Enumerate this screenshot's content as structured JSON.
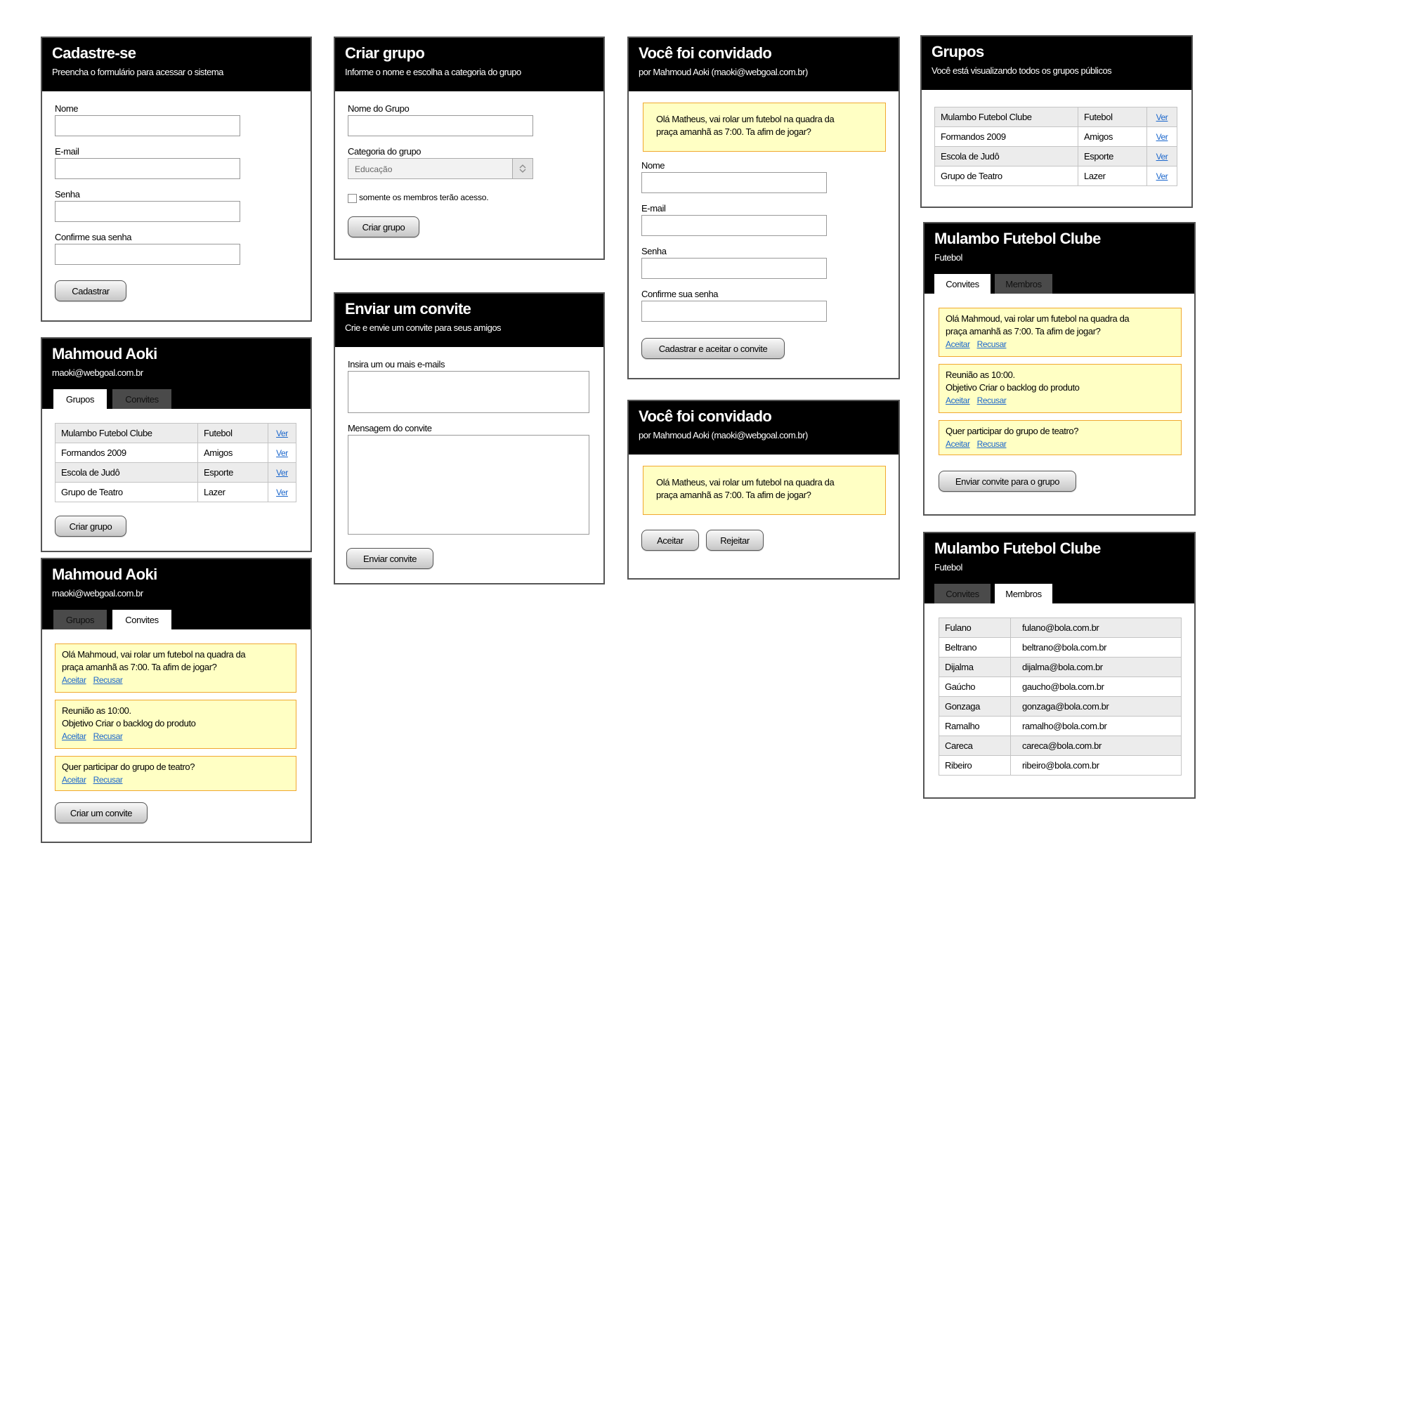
{
  "signup": {
    "title": "Cadastre-se",
    "subtitle": "Preencha o formulário para acessar o sistema",
    "fields": [
      "Nome",
      "E-mail",
      "Senha",
      "Confirme sua senha"
    ],
    "submit": "Cadastrar"
  },
  "profile_groups": {
    "name": "Mahmoud Aoki",
    "email": "maoki@webgoal.com.br",
    "tabs": [
      "Grupos",
      "Convites"
    ],
    "rows": [
      {
        "name": "Mulambo Futebol Clube",
        "category": "Futebol",
        "link": "Ver"
      },
      {
        "name": "Formandos 2009",
        "category": "Amigos",
        "link": "Ver"
      },
      {
        "name": "Escola de Judô",
        "category": "Esporte",
        "link": "Ver"
      },
      {
        "name": "Grupo de Teatro",
        "category": "Lazer",
        "link": "Ver"
      }
    ],
    "button": "Criar grupo"
  },
  "profile_invites": {
    "name": "Mahmoud Aoki",
    "email": "maoki@webgoal.com.br",
    "tabs": [
      "Grupos",
      "Convites"
    ],
    "invites": [
      {
        "line1": "Olá Mahmoud, vai rolar um futebol na quadra da",
        "line2": "praça amanhã as 7:00. Ta afim de jogar?",
        "accept": "Aceitar",
        "decline": "Recusar"
      },
      {
        "line1": "Reunião as 10:00.",
        "line2": "Objetivo Criar o backlog do produto",
        "accept": "Aceitar",
        "decline": "Recusar"
      },
      {
        "line1": "Quer participar do grupo de teatro?",
        "accept": "Aceitar",
        "decline": "Recusar"
      }
    ],
    "button": "Criar um convite"
  },
  "create_group": {
    "title": "Criar grupo",
    "subtitle": "Informe o nome e escolha a categoria do grupo",
    "name_label": "Nome do Grupo",
    "category_label": "Categoria do grupo",
    "category_value": "Educação",
    "checkbox_label": "somente os membros terão acesso.",
    "submit": "Criar grupo"
  },
  "send_invite": {
    "title": "Enviar um convite",
    "subtitle": "Crie e envie um convite para seus amigos",
    "emails_label": "Insira um ou mais e-mails",
    "message_label": "Mensagem do convite",
    "submit": "Enviar convite"
  },
  "invited_signup": {
    "title": "Você foi convidado",
    "subtitle": "por Mahmoud Aoki (maoki@webgoal.com.br)",
    "message_line1": "Olá Matheus, vai rolar um futebol na quadra da",
    "message_line2": "praça amanhã as 7:00. Ta afim de jogar?",
    "fields": [
      "Nome",
      "E-mail",
      "Senha",
      "Confirme sua senha"
    ],
    "submit": "Cadastrar e aceitar o convite"
  },
  "invited_respond": {
    "title": "Você foi convidado",
    "subtitle": "por Mahmoud Aoki (maoki@webgoal.com.br)",
    "message_line1": "Olá Matheus, vai rolar um futebol na quadra da",
    "message_line2": "praça amanhã as 7:00. Ta afim de jogar?",
    "accept": "Aceitar",
    "reject": "Rejeitar"
  },
  "public_groups": {
    "title": "Grupos",
    "subtitle": "Você está visualizando todos os grupos públicos",
    "rows": [
      {
        "name": "Mulambo Futebol Clube",
        "category": "Futebol",
        "link": "Ver"
      },
      {
        "name": "Formandos 2009",
        "category": "Amigos",
        "link": "Ver"
      },
      {
        "name": "Escola de Judô",
        "category": "Esporte",
        "link": "Ver"
      },
      {
        "name": "Grupo de Teatro",
        "category": "Lazer",
        "link": "Ver"
      }
    ]
  },
  "group_invites": {
    "title": "Mulambo Futebol Clube",
    "subtitle": "Futebol",
    "tabs": [
      "Convites",
      "Membros"
    ],
    "invites": [
      {
        "line1": "Olá Mahmoud, vai rolar um futebol na quadra da",
        "line2": "praça amanhã as 7:00. Ta afim de jogar?",
        "accept": "Aceitar",
        "decline": "Recusar"
      },
      {
        "line1": "Reunião as 10:00.",
        "line2": "Objetivo Criar o backlog do produto",
        "accept": "Aceitar",
        "decline": "Recusar"
      },
      {
        "line1": "Quer participar do grupo de teatro?",
        "accept": "Aceitar",
        "decline": "Recusar"
      }
    ],
    "button": "Enviar convite para o grupo"
  },
  "group_members": {
    "title": "Mulambo Futebol Clube",
    "subtitle": "Futebol",
    "tabs": [
      "Convites",
      "Membros"
    ],
    "members": [
      {
        "name": "Fulano",
        "email": "fulano@bola.com.br"
      },
      {
        "name": "Beltrano",
        "email": "beltrano@bola.com.br"
      },
      {
        "name": "Dijalma",
        "email": "dijalma@bola.com.br"
      },
      {
        "name": "Gaúcho",
        "email": "gaucho@bola.com.br"
      },
      {
        "name": "Gonzaga",
        "email": "gonzaga@bola.com.br"
      },
      {
        "name": "Ramalho",
        "email": "ramalho@bola.com.br"
      },
      {
        "name": "Careca",
        "email": "careca@bola.com.br"
      },
      {
        "name": "Ribeiro",
        "email": "ribeiro@bola.com.br"
      }
    ]
  }
}
